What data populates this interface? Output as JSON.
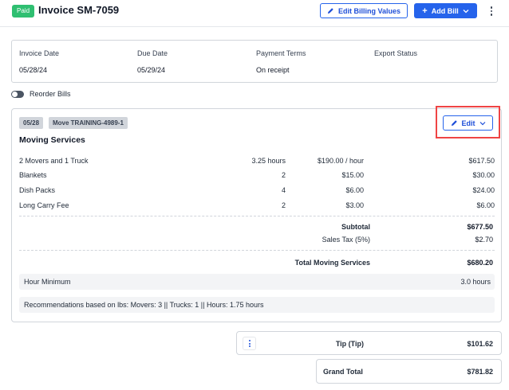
{
  "header": {
    "status_badge": "Paid",
    "title": "Invoice SM-7059",
    "edit_billing_label": "Edit Billing Values",
    "add_bill_label": "Add Bill"
  },
  "summary": {
    "invoice_date_label": "Invoice Date",
    "invoice_date": "05/28/24",
    "due_date_label": "Due Date",
    "due_date": "05/29/24",
    "payment_terms_label": "Payment Terms",
    "payment_terms": "On receipt",
    "export_status_label": "Export Status",
    "export_status": ""
  },
  "reorder": {
    "label": "Reorder Bills",
    "enabled": false
  },
  "bill": {
    "date_chip": "05/28",
    "move_chip": "Move TRAINING-4989-1",
    "edit_label": "Edit",
    "section_title": "Moving Services",
    "items": [
      {
        "name": "2 Movers and 1 Truck",
        "qty": "3.25 hours",
        "rate": "$190.00 / hour",
        "amount": "$617.50"
      },
      {
        "name": "Blankets",
        "qty": "2",
        "rate": "$15.00",
        "amount": "$30.00"
      },
      {
        "name": "Dish Packs",
        "qty": "4",
        "rate": "$6.00",
        "amount": "$24.00"
      },
      {
        "name": "Long Carry Fee",
        "qty": "2",
        "rate": "$3.00",
        "amount": "$6.00"
      }
    ],
    "subtotal_label": "Subtotal",
    "subtotal": "$677.50",
    "tax_label": "Sales Tax (5%)",
    "tax": "$2.70",
    "total_label": "Total Moving Services",
    "total": "$680.20",
    "hour_min_label": "Hour Minimum",
    "hour_min_value": "3.0 hours",
    "recommendation": "Recommendations based on lbs:  Movers: 3 || Trucks: 1 || Hours: 1.75 hours"
  },
  "tip": {
    "label": "Tip (Tip)",
    "value": "$101.62"
  },
  "grand_total": {
    "label": "Grand Total",
    "value": "$781.82"
  },
  "colors": {
    "primary": "#2563eb",
    "paid": "#2fbf71",
    "highlight": "#ef4444"
  }
}
